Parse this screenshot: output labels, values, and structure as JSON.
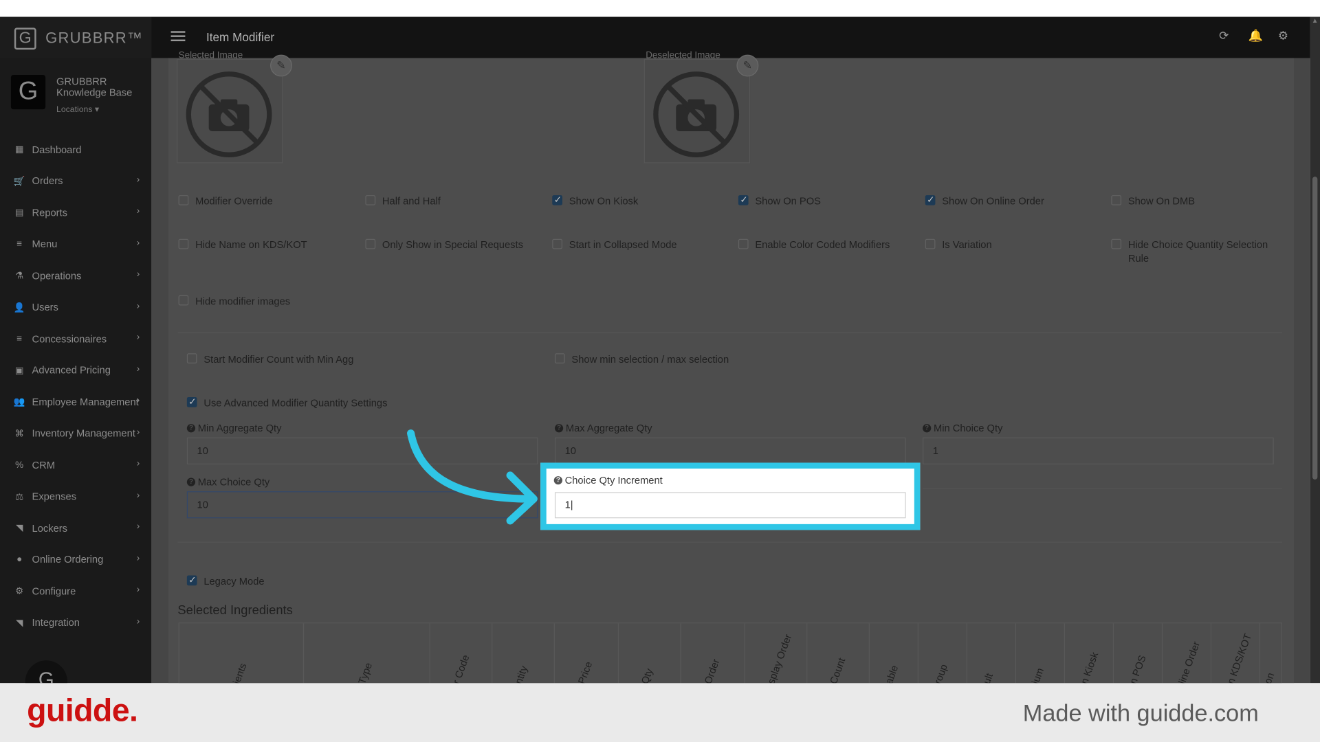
{
  "brand": {
    "logo_letter": "G",
    "name": "GRUBBRR™"
  },
  "header": {
    "title": "Item Modifier",
    "icons": [
      "refresh-icon",
      "bell-icon",
      "gear-icon"
    ]
  },
  "sidebar": {
    "avatar_letter": "G",
    "org_name": "GRUBBRR Knowledge Base",
    "locations_label": "Locations ▾",
    "items": [
      {
        "label": "Dashboard",
        "icon": "▦",
        "chevron": false
      },
      {
        "label": "Orders",
        "icon": "🛒",
        "chevron": true
      },
      {
        "label": "Reports",
        "icon": "▤",
        "chevron": true
      },
      {
        "label": "Menu",
        "icon": "≡",
        "chevron": true
      },
      {
        "label": "Operations",
        "icon": "⚗",
        "chevron": true
      },
      {
        "label": "Users",
        "icon": "👤",
        "chevron": true
      },
      {
        "label": "Concessionaires",
        "icon": "≡",
        "chevron": true
      },
      {
        "label": "Advanced Pricing",
        "icon": "▣",
        "chevron": true
      },
      {
        "label": "Employee Management",
        "icon": "👥",
        "chevron": true
      },
      {
        "label": "Inventory Management",
        "icon": "⌘",
        "chevron": true
      },
      {
        "label": "CRM",
        "icon": "%",
        "chevron": true
      },
      {
        "label": "Expenses",
        "icon": "⚖",
        "chevron": true
      },
      {
        "label": "Lockers",
        "icon": "◥",
        "chevron": true
      },
      {
        "label": "Online Ordering",
        "icon": "●",
        "chevron": true
      },
      {
        "label": "Configure",
        "icon": "⚙",
        "chevron": true
      },
      {
        "label": "Integration",
        "icon": "◥",
        "chevron": true
      }
    ],
    "bottom_avatar_letter": "G"
  },
  "images": {
    "left_label": "Selected Image",
    "right_label": "Deselected Image"
  },
  "checkboxes_row1": [
    {
      "label": "Modifier Override",
      "checked": false
    },
    {
      "label": "Half and Half",
      "checked": false
    },
    {
      "label": "Show On Kiosk",
      "checked": true
    },
    {
      "label": "Show On POS",
      "checked": true
    },
    {
      "label": "Show On Online Order",
      "checked": true
    },
    {
      "label": "Show On DMB",
      "checked": false
    }
  ],
  "checkboxes_row2": [
    {
      "label": "Hide Name on KDS/KOT",
      "checked": false
    },
    {
      "label": "Only Show in Special Requests",
      "checked": false
    },
    {
      "label": "Start in Collapsed Mode",
      "checked": false
    },
    {
      "label": "Enable Color Coded Modifiers",
      "checked": false
    },
    {
      "label": "Is Variation",
      "checked": false
    },
    {
      "label": "Hide Choice Quantity Selection Rule",
      "checked": false
    }
  ],
  "checkbox_hide_images": {
    "label": "Hide modifier images",
    "checked": false
  },
  "checkbox_start_count": {
    "label": "Start Modifier Count with Min Agg",
    "checked": false
  },
  "checkbox_show_minmax": {
    "label": "Show min selection / max selection",
    "checked": false
  },
  "checkbox_advanced": {
    "label": "Use Advanced Modifier Quantity Settings",
    "checked": true
  },
  "fields": {
    "min_agg": {
      "label": "Min Aggregate Qty",
      "value": "10"
    },
    "max_agg": {
      "label": "Max Aggregate Qty",
      "value": "10"
    },
    "min_choice": {
      "label": "Min Choice Qty",
      "value": "1"
    },
    "max_choice": {
      "label": "Max Choice Qty",
      "value": "10"
    },
    "choice_increment": {
      "label": "Choice Qty Increment",
      "value": "1|"
    }
  },
  "checkbox_legacy": {
    "label": "Legacy Mode",
    "checked": true
  },
  "ingredients": {
    "title": "Selected Ingredients",
    "columns": [
      "ients",
      "Type",
      "r Code",
      "ntity",
      "Price",
      "Qty",
      "Order",
      "splay Order",
      "Count",
      "able",
      "roup",
      "ult",
      "ium",
      "n Kiosk",
      "n POS",
      "line Order",
      "n KDS/KOT",
      "on"
    ]
  },
  "footer": {
    "logo": "guidde.",
    "tagline": "Made with guidde.com"
  },
  "colors": {
    "highlight": "#2fc6e6",
    "guidde_red": "#cc1111",
    "checked": "#1d3a55"
  }
}
